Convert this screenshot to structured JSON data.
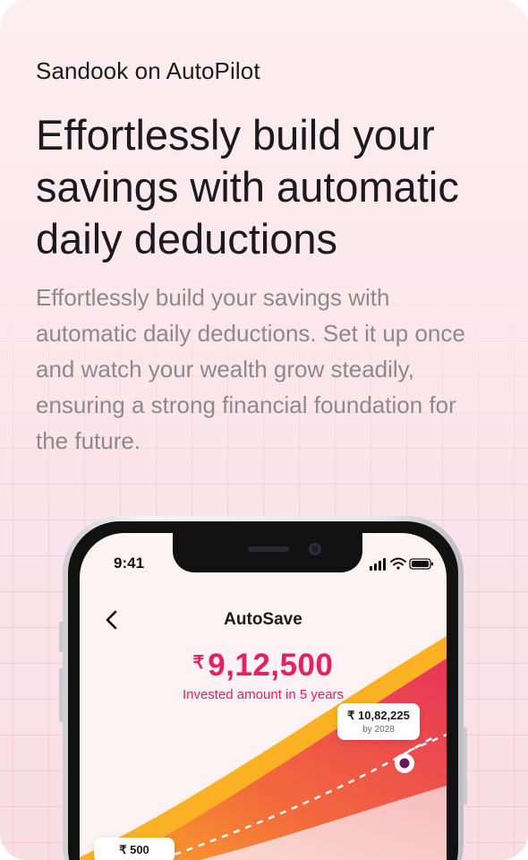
{
  "page": {
    "eyebrow": "Sandook on AutoPilot",
    "headline": "Effortlessly build your savings with automatic daily deductions",
    "body": "Effortlessly build your savings with automatic daily deductions. Set it up once and watch your wealth grow steadily, ensuring a strong financial foundation for the future."
  },
  "phone": {
    "status_time": "9:41",
    "status_icons": [
      "signal-icon",
      "wifi-icon",
      "battery-icon"
    ],
    "back_icon": "chevron-left-icon",
    "title": "AutoSave",
    "currency_symbol": "₹",
    "invested_amount": "9,12,500",
    "invested_caption": "Invested amount in 5 years",
    "projection_value": "₹ 10,82,225",
    "projection_caption": "by 2028",
    "daily_value": "₹ 500"
  },
  "colors": {
    "accent": "#e5225f",
    "curve_outer": "#fbb124",
    "curve_mid": "#f26a3c",
    "curve_inner": "#e8345a",
    "text_dark": "#1b1b1f",
    "text_muted": "#8c8a8d",
    "background": "#fdeef1"
  }
}
